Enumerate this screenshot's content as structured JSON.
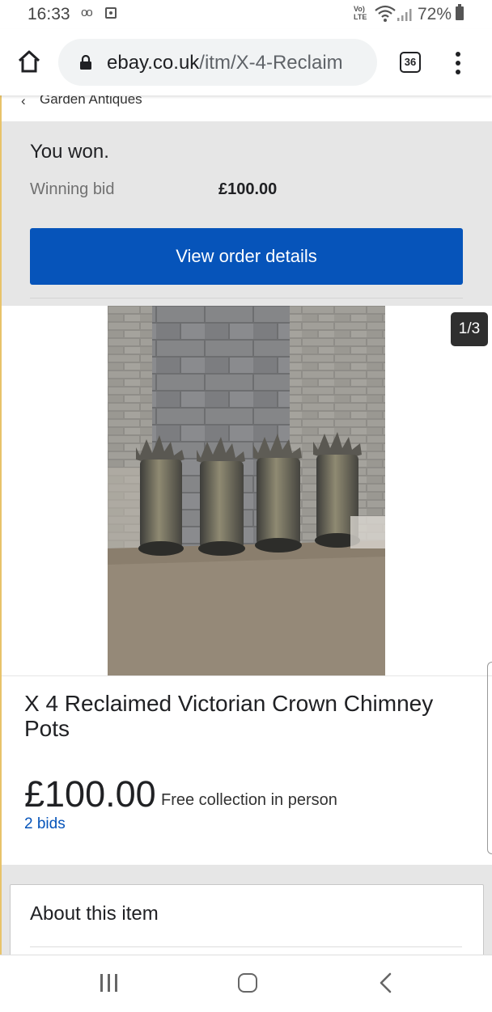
{
  "status_bar": {
    "time": "16:33",
    "volte_label": "Vo)\nLTE",
    "battery_percent": "72%",
    "icons": [
      "voicemail-icon",
      "notification-icon",
      "volte-icon",
      "wifi-icon",
      "signal-icon",
      "battery-icon"
    ]
  },
  "browser": {
    "url_host": "ebay.co.uk",
    "url_path": "/itm/X-4-Reclaim",
    "tab_count": "36",
    "icons": [
      "home-icon",
      "lock-icon",
      "tabs-icon",
      "menu-icon"
    ]
  },
  "breadcrumb": {
    "label": "Garden Antiques",
    "icon": "chevron-left-icon"
  },
  "won_panel": {
    "title": "You won.",
    "winning_bid_label": "Winning bid",
    "winning_bid_value": "£100.00",
    "button_label": "View order details",
    "button_color": "#0654ba"
  },
  "gallery": {
    "counter": "1/3",
    "image_alt": "product-photo"
  },
  "item": {
    "title": "X 4 Reclaimed Victorian Crown Chimney Pots",
    "price": "£100.00",
    "shipping": "Free collection in person",
    "bids": "2 bids"
  },
  "about": {
    "title": "About this item"
  },
  "nav_bar": {
    "icons": [
      "recent-apps-icon",
      "home-button-icon",
      "back-icon"
    ]
  }
}
